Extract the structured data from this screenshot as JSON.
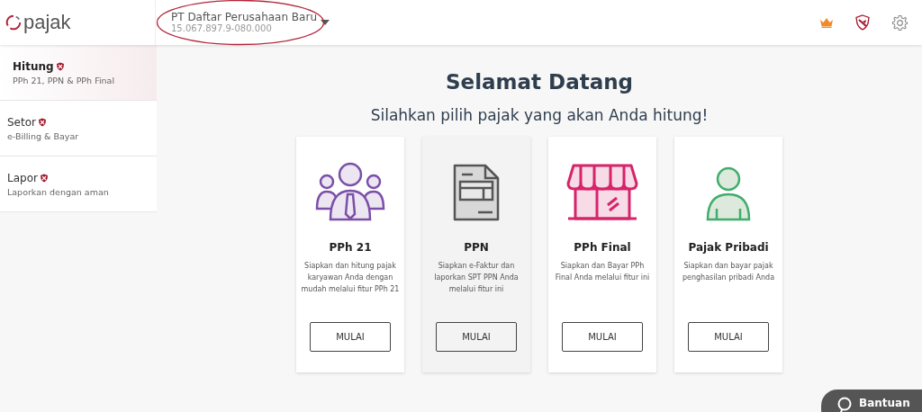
{
  "header": {
    "logo": "pajak",
    "company": {
      "name": "PT Daftar Perusahaan Baru",
      "npwp": "15.067.897.9-080.000",
      "highlighted": true
    }
  },
  "sidebar": {
    "items": [
      {
        "title": "Hitung",
        "subtitle": "PPh 21, PPN & PPh Final",
        "selected": true
      },
      {
        "title": "Setor",
        "subtitle": "e-Billing & Bayar",
        "selected": false
      },
      {
        "title": "Lapor",
        "subtitle": "Laporkan dengan aman",
        "selected": false
      }
    ]
  },
  "main": {
    "title": "Selamat Datang",
    "subtitle": "Silahkan pilih pajak yang akan Anda hitung!",
    "cards": [
      {
        "kind": "people",
        "title": "PPh 21",
        "description": "Siapkan dan hitung pajak karyawan Anda dengan mudah melalui fitur PPh 21",
        "button": "MULAI",
        "selected": false
      },
      {
        "kind": "document",
        "title": "PPN",
        "description": "Siapkan e-Faktur dan laporkan SPT PPN Anda melalui fitur ini",
        "button": "MULAI",
        "selected": true
      },
      {
        "kind": "store",
        "title": "PPh Final",
        "description": "Siapkan dan Bayar PPh Final Anda melalui fitur ini",
        "button": "MULAI",
        "selected": false
      },
      {
        "kind": "person",
        "title": "Pajak Pribadi",
        "description": "Siapkan dan bayar pajak penghasilan pribadi Anda",
        "button": "MULAI",
        "selected": false
      }
    ]
  },
  "help_button": {
    "label": "Bantuan"
  }
}
